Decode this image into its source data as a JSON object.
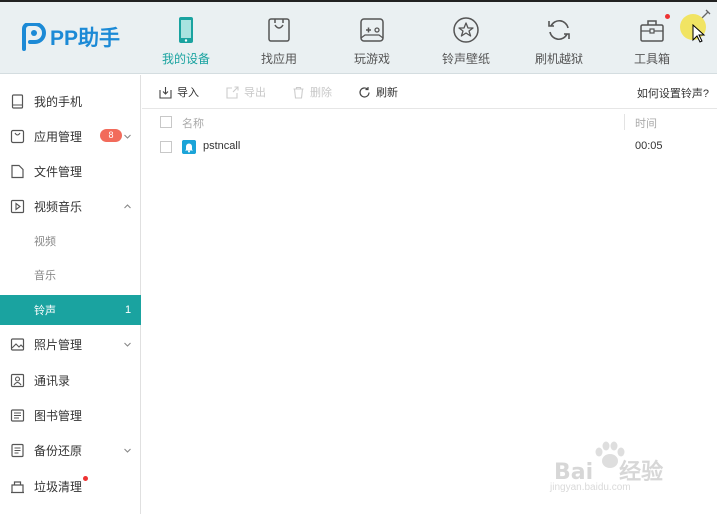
{
  "app": {
    "logo_text": "PP助手"
  },
  "nav": {
    "tabs": [
      {
        "label": "我的设备",
        "icon": "phone-icon",
        "active": true
      },
      {
        "label": "找应用",
        "icon": "app-bag-icon",
        "active": false
      },
      {
        "label": "玩游戏",
        "icon": "gamepad-icon",
        "active": false
      },
      {
        "label": "铃声壁纸",
        "icon": "star-icon",
        "active": false
      },
      {
        "label": "刷机越狱",
        "icon": "refresh-icon",
        "active": false
      },
      {
        "label": "工具箱",
        "icon": "toolbox-icon",
        "active": false
      }
    ]
  },
  "sidebar": {
    "items": [
      {
        "label": "我的手机",
        "icon": "tablet-icon"
      },
      {
        "label": "应用管理",
        "icon": "app-icon",
        "badge": "8"
      },
      {
        "label": "文件管理",
        "icon": "file-icon"
      },
      {
        "label": "视频音乐",
        "icon": "video-icon"
      },
      {
        "label": "照片管理",
        "icon": "photo-icon"
      },
      {
        "label": "通讯录",
        "icon": "contacts-icon"
      },
      {
        "label": "图书管理",
        "icon": "book-icon"
      },
      {
        "label": "备份还原",
        "icon": "backup-icon"
      },
      {
        "label": "垃圾清理",
        "icon": "trash-icon"
      }
    ],
    "sub_items": [
      {
        "label": "视频"
      },
      {
        "label": "音乐"
      },
      {
        "label": "铃声",
        "count": "1",
        "active": true
      }
    ]
  },
  "toolbar": {
    "import_label": "导入",
    "export_label": "导出",
    "delete_label": "删除",
    "refresh_label": "刷新",
    "help_link": "如何设置铃声?"
  },
  "table": {
    "columns": [
      "名称",
      "时间"
    ],
    "rows": [
      {
        "name": "pstncall",
        "time": "00:05"
      }
    ]
  },
  "watermark": {
    "brand": "Bai",
    "suffix": "经验",
    "url": "jingyan.baidu.com"
  },
  "colors": {
    "accent": "#1aa3a0",
    "logo_blue": "#1c8ad6",
    "badge_red": "#f26b5b"
  }
}
